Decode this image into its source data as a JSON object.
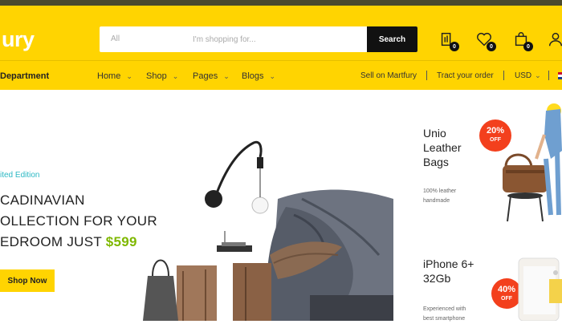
{
  "header": {
    "logo": "ury",
    "search": {
      "category": "All",
      "placeholder": "I'm shopping for...",
      "button_label": "Search"
    },
    "icons": [
      {
        "name": "compare-icon",
        "count": "0"
      },
      {
        "name": "heart-icon",
        "count": "0"
      },
      {
        "name": "cart-icon",
        "count": "0"
      },
      {
        "name": "user-icon"
      }
    ]
  },
  "nav": {
    "department_label": "Department",
    "menu": [
      {
        "label": "Home"
      },
      {
        "label": "Shop"
      },
      {
        "label": "Pages"
      },
      {
        "label": "Blogs"
      }
    ],
    "right_links": {
      "sell": "Sell on Martfury",
      "track": "Tract your order",
      "currency": "USD"
    }
  },
  "hero": {
    "tag": "ited Edition",
    "line1": "CADINAVIAN",
    "line2": "OLLECTION FOR YOUR",
    "line3_prefix": "EDROOM JUST ",
    "price": "$599",
    "button_label": "Shop Now"
  },
  "promos": [
    {
      "title_lines": [
        "Unio",
        "Leather",
        "Bags"
      ],
      "subtitle_lines": [
        "100% leather",
        "handmade"
      ],
      "discount": "20%",
      "off_label": "OFF"
    },
    {
      "title_lines": [
        "iPhone 6+",
        "32Gb"
      ],
      "subtitle_lines": [
        "Experienced with",
        "best smartphone"
      ],
      "discount": "40%",
      "off_label": "OFF"
    }
  ],
  "colors": {
    "brand_yellow": "#ffd401",
    "price_green": "#7fb800",
    "discount_red": "#f3401d",
    "tag_cyan": "#2bb8c4"
  }
}
